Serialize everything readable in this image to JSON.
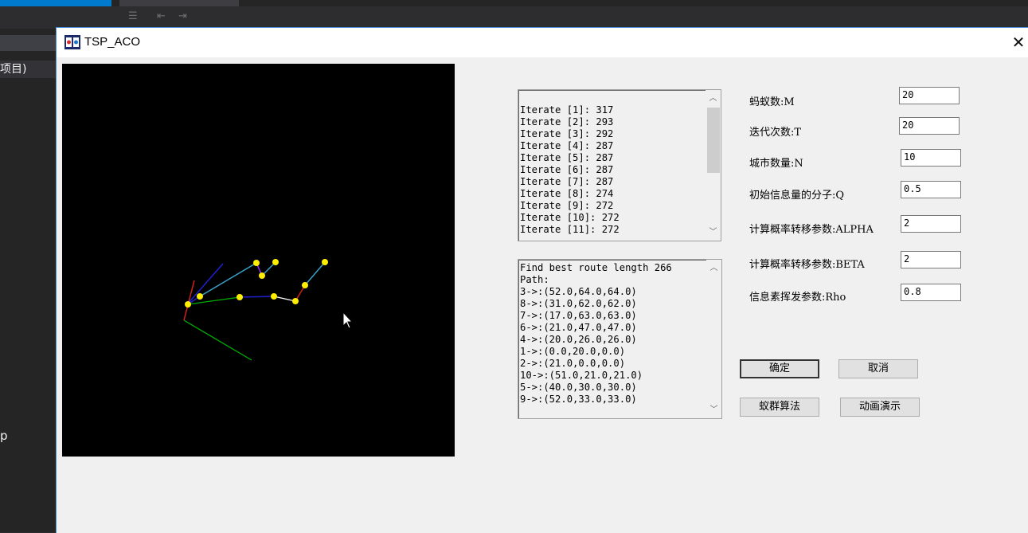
{
  "window": {
    "title": "TSP_ACO"
  },
  "ide": {
    "sidebar_row": "项目)",
    "sidebar_letter": "p"
  },
  "iterations": [
    "Iterate [1]: 317",
    "Iterate [2]: 293",
    "Iterate [3]: 292",
    "Iterate [4]: 287",
    "Iterate [5]: 287",
    "Iterate [6]: 287",
    "Iterate [7]: 287",
    "Iterate [8]: 274",
    "Iterate [9]: 272",
    "Iterate [10]: 272",
    "Iterate [11]: 272"
  ],
  "result": [
    "Find best route length 266",
    "Path:",
    "3->:(52.0,64.0,64.0)",
    "8->:(31.0,62.0,62.0)",
    "7->:(17.0,63.0,63.0)",
    "6->:(21.0,47.0,47.0)",
    "4->:(20.0,26.0,26.0)",
    "1->:(0.0,20.0,0.0)",
    "2->:(21.0,0.0,0.0)",
    "10->:(51.0,21.0,21.0)",
    "5->:(40.0,30.0,30.0)",
    "9->:(52.0,33.0,33.0)"
  ],
  "params": {
    "ants": {
      "label": "蚂蚁数:M",
      "value": "20"
    },
    "iters": {
      "label": "迭代次数:T",
      "value": "20"
    },
    "cities": {
      "label": "城市数量:N",
      "value": "10"
    },
    "q": {
      "label": "初始信息量的分子:Q",
      "value": "0.5"
    },
    "alpha": {
      "label": "计算概率转移参数:ALPHA",
      "value": "2"
    },
    "beta": {
      "label": "计算概率转移参数:BETA",
      "value": "2"
    },
    "rho": {
      "label": "信息素挥发参数:Rho",
      "value": "0.8"
    }
  },
  "buttons": {
    "ok": "确定",
    "cancel": "取消",
    "aco": "蚁群算法",
    "animate": "动画演示"
  },
  "colors": {
    "canvas_bg": "#000000",
    "node": "#ffee00",
    "axis_x": "#00b000",
    "axis_y": "#d02020",
    "axis_z": "#2020d0",
    "edge_cyan": "#3aa0c8",
    "edge_white": "#ffffff"
  }
}
